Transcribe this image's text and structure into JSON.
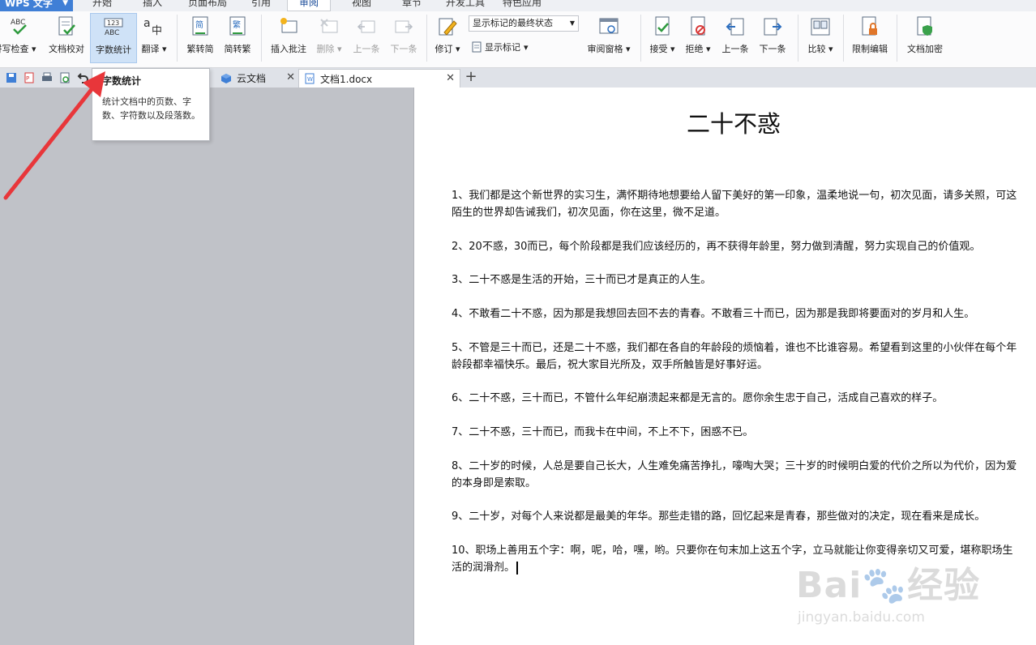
{
  "menubar": {
    "app_label": "WPS 文字",
    "tabs": [
      "开始",
      "插入",
      "页面布局",
      "引用",
      "审阅",
      "视图",
      "章节",
      "开发工具",
      "特色应用"
    ],
    "active_tab": "审阅"
  },
  "ribbon": {
    "spell_check": "拼写检查",
    "doc_proof": "文档校对",
    "word_count": "字数统计",
    "translate": "翻译",
    "trad_to_simp": "繁转简",
    "simp_to_trad": "简转繁",
    "insert_comment": "插入批注",
    "delete": "删除",
    "prev": "上一条",
    "next": "下一条",
    "track_changes": "修订",
    "markup_select": "显示标记的最终状态",
    "show_markup": "显示标记",
    "review_pane": "审阅窗格",
    "accept": "接受",
    "reject": "拒绝",
    "prev_change": "上一条",
    "next_change": "下一条",
    "compare": "比较",
    "restrict_edit": "限制编辑",
    "encrypt": "文档加密",
    "accent_color": "#3f7fd6"
  },
  "tabs": {
    "cloud": "云文档",
    "doc": "文档1.docx"
  },
  "tooltip": {
    "title": "字数统计",
    "body": "统计文档中的页数、字数、字符数以及段落数。"
  },
  "document": {
    "title": "二十不惑",
    "paragraphs": [
      "1、我们都是这个新世界的实习生，满怀期待地想要给人留下美好的第一印象，温柔地说一句，初次见面，请多关照，可这陌生的世界却告诫我们，初次见面，你在这里，微不足道。",
      "2、20不惑，30而已，每个阶段都是我们应该经历的，再不获得年龄里，努力做到清醒，努力实现自己的价值观。",
      "3、二十不惑是生活的开始，三十而已才是真正的人生。",
      "4、不敢看二十不惑，因为那是我想回去回不去的青春。不敢看三十而已，因为那是我即将要面对的岁月和人生。",
      "5、不管是三十而已，还是二十不惑，我们都在各自的年龄段的烦恼着，谁也不比谁容易。希望看到这里的小伙伴在每个年龄段都幸福快乐。最后，祝大家目光所及，双手所触皆是好事好运。",
      "6、二十不惑，三十而已，不管什么年纪崩溃起来都是无言的。愿你余生忠于自己，活成自己喜欢的样子。",
      "7、二十不惑，三十而已，而我卡在中间，不上不下，困惑不已。",
      "8、二十岁的时候，人总是要自己长大，人生难免痛苦挣扎，嚎啕大哭；三十岁的时候明白爱的代价之所以为代价，因为爱的本身即是索取。",
      "9、二十岁，对每个人来说都是最美的年华。那些走错的路，回忆起来是青春，那些做对的决定，现在看来是成长。",
      "10、职场上善用五个字：啊，呢，哈，嘿，哟。只要你在句末加上这五个字，立马就能让你变得亲切又可爱，堪称职场生活的润滑剂。"
    ]
  },
  "watermark": {
    "main": "Bai🐾经验",
    "sub": "jingyan.baidu.com"
  },
  "arrow_color": "#e8363a"
}
